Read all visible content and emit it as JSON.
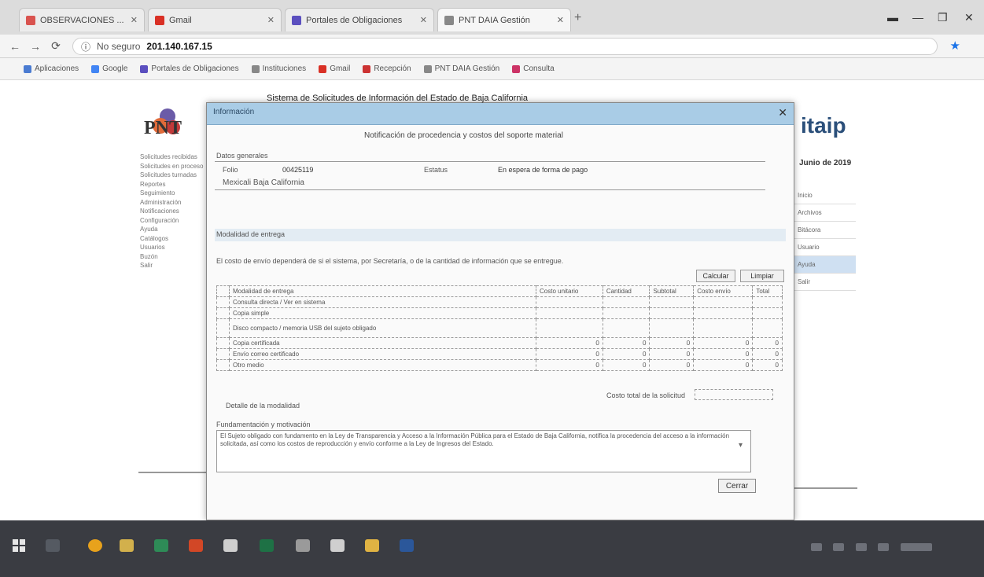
{
  "browser": {
    "tabs": [
      {
        "label": "OBSERVACIONES ...",
        "color": "#d9534f"
      },
      {
        "label": "Gmail",
        "color": "#d93025"
      },
      {
        "label": "Portales de Obligaciones",
        "color": "#5b4fbf"
      },
      {
        "label": "PNT DAIA Gestión",
        "color": "#888888"
      }
    ],
    "address": {
      "security": "No seguro",
      "url": "201.140.167.15"
    },
    "bookmarks": [
      {
        "label": "Aplicaciones",
        "color": "#4a7bd1"
      },
      {
        "label": "Google",
        "color": "#4285f4"
      },
      {
        "label": "Portales de Obligaciones",
        "color": "#5b4fbf"
      },
      {
        "label": "Instituciones",
        "color": "#888888"
      },
      {
        "label": "Gmail",
        "color": "#d93025"
      },
      {
        "label": "Recepción",
        "color": "#cc3333"
      },
      {
        "label": "PNT DAIA Gestión",
        "color": "#888888"
      },
      {
        "label": "Consulta",
        "color": "#cc3366"
      }
    ]
  },
  "page": {
    "logo_text": "PNT",
    "brand_right": "itaip",
    "heading": "Sistema de Solicitudes de Información del Estado de Baja California",
    "date": "Junio de 2019",
    "left_menu": [
      "Solicitudes recibidas",
      "Solicitudes en proceso",
      "Solicitudes turnadas",
      "Reportes",
      "Seguimiento",
      "Administración",
      "Notificaciones",
      "Configuración",
      "Ayuda",
      "Catálogos",
      "Usuarios",
      "Buzón",
      "Salir"
    ],
    "right_menu": [
      "Inicio",
      "Archivos",
      "Bitácora",
      "Usuario",
      "Ayuda",
      "Salir"
    ]
  },
  "modal": {
    "title": "Información",
    "subtitle": "Notificación de procedencia y costos del soporte material",
    "general_section": "Datos generales",
    "folio_label": "Folio",
    "folio_value": "00425119",
    "status_label": "Estatus",
    "status_value": "En espera de forma de pago",
    "entity_value": "Mexicali Baja California",
    "delivery_section": "Modalidad de entrega",
    "notice": "El costo de envío dependerá de si el sistema, por Secretaría, o de la cantidad de información que se entregue.",
    "calc_button": "Calcular",
    "clear_button": "Limpiar",
    "table": {
      "headers": [
        "",
        "Modalidad de entrega",
        "Costo unitario",
        "Cantidad",
        "Subtotal",
        "Costo envío",
        "Total"
      ],
      "rows": [
        {
          "label": "Consulta directa / Ver en sistema",
          "unit": "",
          "qty": "",
          "sub": "",
          "ship": "",
          "total": ""
        },
        {
          "label": "Copia simple",
          "unit": "",
          "qty": "",
          "sub": "",
          "ship": "",
          "total": ""
        },
        {
          "label": "Disco compacto / memoria USB del sujeto obligado",
          "unit": "",
          "qty": "",
          "sub": "",
          "ship": "",
          "total": ""
        },
        {
          "label": "Copia certificada",
          "unit": "0",
          "qty": "0",
          "sub": "0",
          "ship": "0",
          "total": "0"
        },
        {
          "label": "Envío correo certificado",
          "unit": "0",
          "qty": "0",
          "sub": "0",
          "ship": "0",
          "total": "0"
        },
        {
          "label": "Otro medio",
          "unit": "0",
          "qty": "0",
          "sub": "0",
          "ship": "0",
          "total": "0"
        }
      ]
    },
    "total_label": "Costo total de la solicitud",
    "prelim_label": "Detalle de la modalidad",
    "notes_label": "Fundamentación y motivación",
    "notes_text": "El Sujeto obligado con fundamento en la Ley de Transparencia y Acceso a la Información Pública para el Estado de Baja California, notifica la procedencia del acceso a la información solicitada, así como los costos de reproducción y envío conforme a la Ley de Ingresos del Estado.",
    "close_button": "Cerrar"
  },
  "taskbar": {
    "icons": [
      {
        "name": "chrome",
        "color": "#e8a21c"
      },
      {
        "name": "explorer",
        "color": "#d2b04c"
      },
      {
        "name": "excel",
        "color": "#2e8b57"
      },
      {
        "name": "powerpoint",
        "color": "#d24726"
      },
      {
        "name": "mail",
        "color": "#cfcfcf"
      },
      {
        "name": "excel2",
        "color": "#1e7145"
      },
      {
        "name": "calculator",
        "color": "#9a9a9a"
      },
      {
        "name": "notepad",
        "color": "#cfcfcf"
      },
      {
        "name": "folder",
        "color": "#e0b343"
      },
      {
        "name": "word",
        "color": "#2b579a"
      }
    ]
  }
}
